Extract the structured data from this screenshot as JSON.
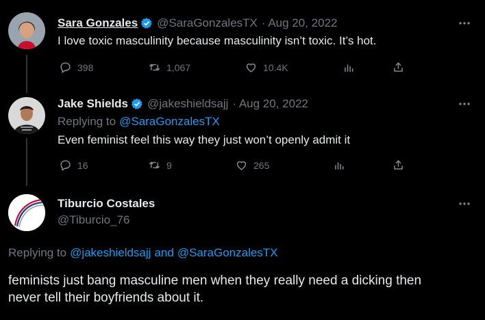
{
  "tweets": [
    {
      "name": "Sara Gonzales",
      "handle": "@SaraGonzalesTX",
      "date": "· Aug 20, 2022",
      "text": "I love toxic masculinity because masculinity isn’t toxic. It’s hot.",
      "stats": {
        "replies": "398",
        "retweets": "1,067",
        "likes": "10.4K"
      }
    },
    {
      "name": "Jake Shields",
      "handle": "@jakeshieldsajj",
      "date": "· Aug 20, 2022",
      "replying_prefix": "Replying to",
      "replying_to": "@SaraGonzalesTX",
      "text": "Even feminist feel this way they just won’t openly admit it",
      "stats": {
        "replies": "16",
        "retweets": "9",
        "likes": "265"
      }
    },
    {
      "name": "Tiburcio Costales",
      "handle": "@Tiburcio_76",
      "replying_prefix": "Replying to",
      "replying_to_1": "@jakeshieldsajj",
      "replying_and": "and",
      "replying_to_2": "@SaraGonzalesTX",
      "text_line1": "feminists just bang masculine men when they really need a dicking then",
      "text_line2": "never tell their boyfriends about it."
    }
  ],
  "colors": {
    "accent": "#1d9bf0",
    "muted": "#71767b",
    "text": "#e7e9ea",
    "background": "#000000"
  },
  "icons": [
    "verified-badge-icon",
    "more-icon",
    "reply-icon",
    "retweet-icon",
    "like-icon",
    "views-icon",
    "share-icon"
  ]
}
